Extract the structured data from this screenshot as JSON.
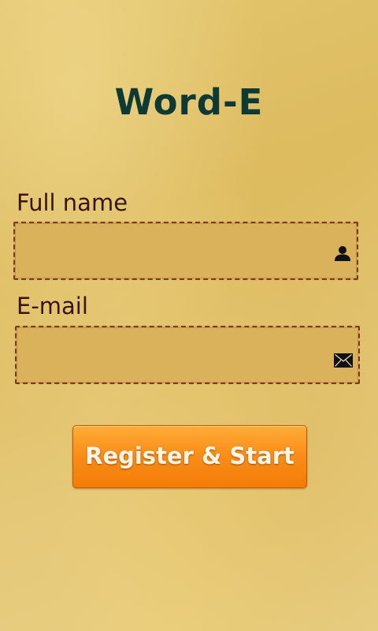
{
  "app": {
    "title": "Word-E"
  },
  "form": {
    "full_name": {
      "label": "Full name",
      "value": "",
      "icon": "person-icon"
    },
    "email": {
      "label": "E-mail",
      "value": "",
      "icon": "envelope-icon"
    },
    "submit_label": "Register & Start"
  },
  "colors": {
    "title": "#0e3a35",
    "label": "#3a1414",
    "field_fill": "#d9b25b",
    "field_border": "#7a3a1e",
    "button": "#fb8f19",
    "background": "#e3c66f"
  }
}
